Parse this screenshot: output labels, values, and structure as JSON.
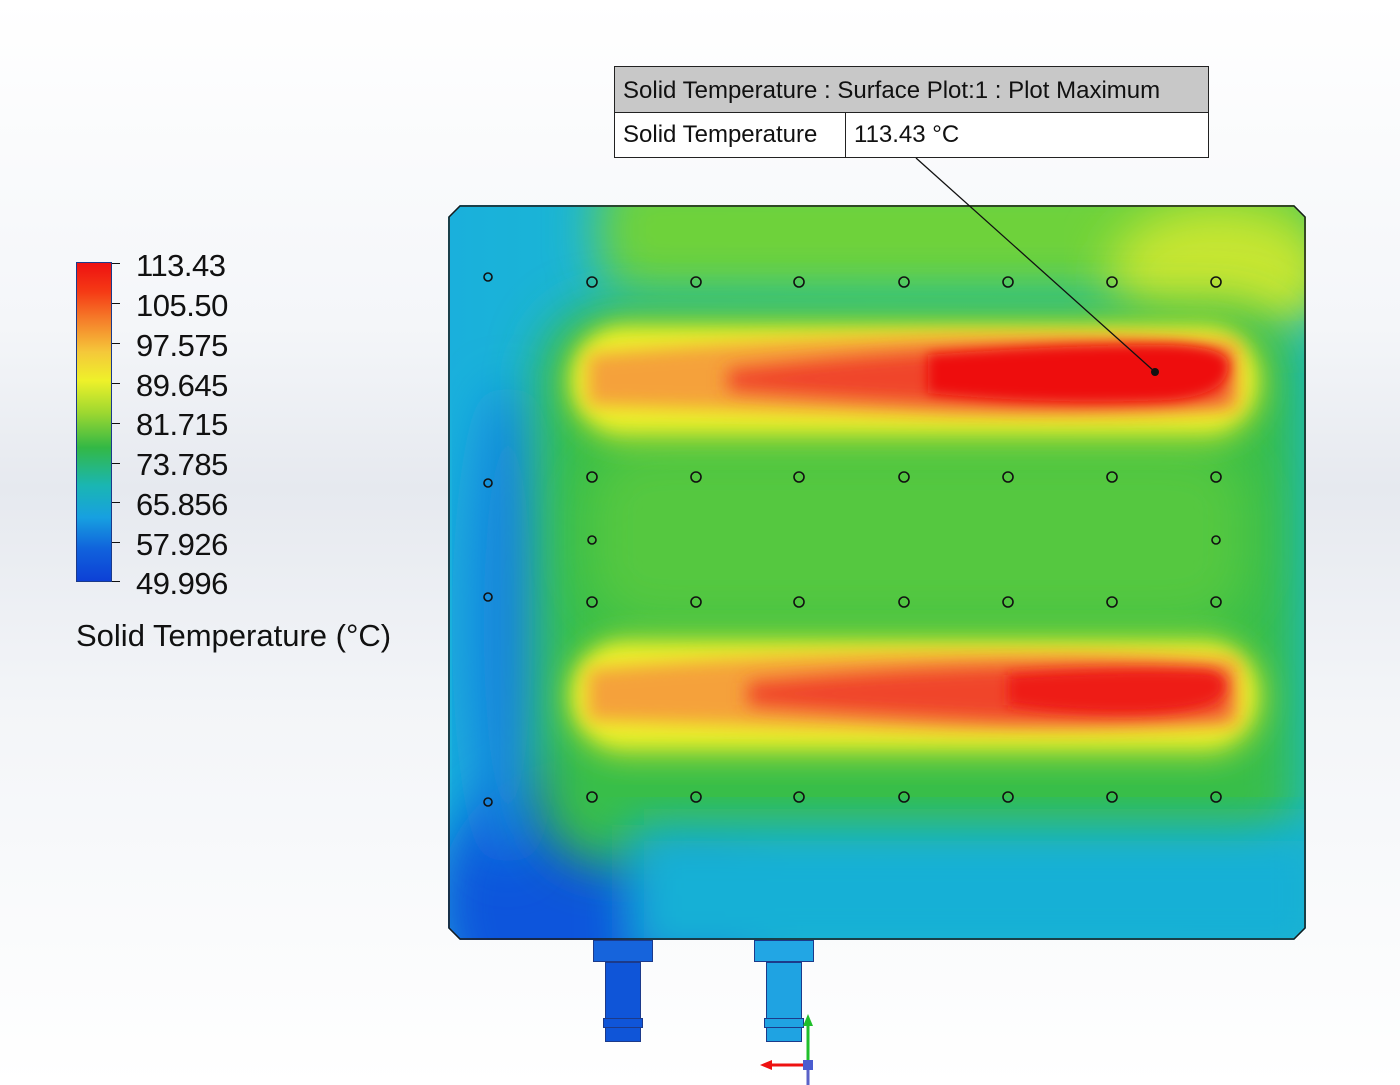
{
  "legend": {
    "ticks": [
      "113.43",
      "105.50",
      "97.575",
      "89.645",
      "81.715",
      "73.785",
      "65.856",
      "57.926",
      "49.996"
    ],
    "title": "Solid Temperature (°C)"
  },
  "callout": {
    "header": "Solid Temperature : Surface Plot:1 : Plot Maximum",
    "label": "Solid Temperature",
    "value": "113.43 °C"
  },
  "colors": {
    "max": "#ee1111",
    "min": "#0d40d6",
    "mid": "#33b845"
  }
}
